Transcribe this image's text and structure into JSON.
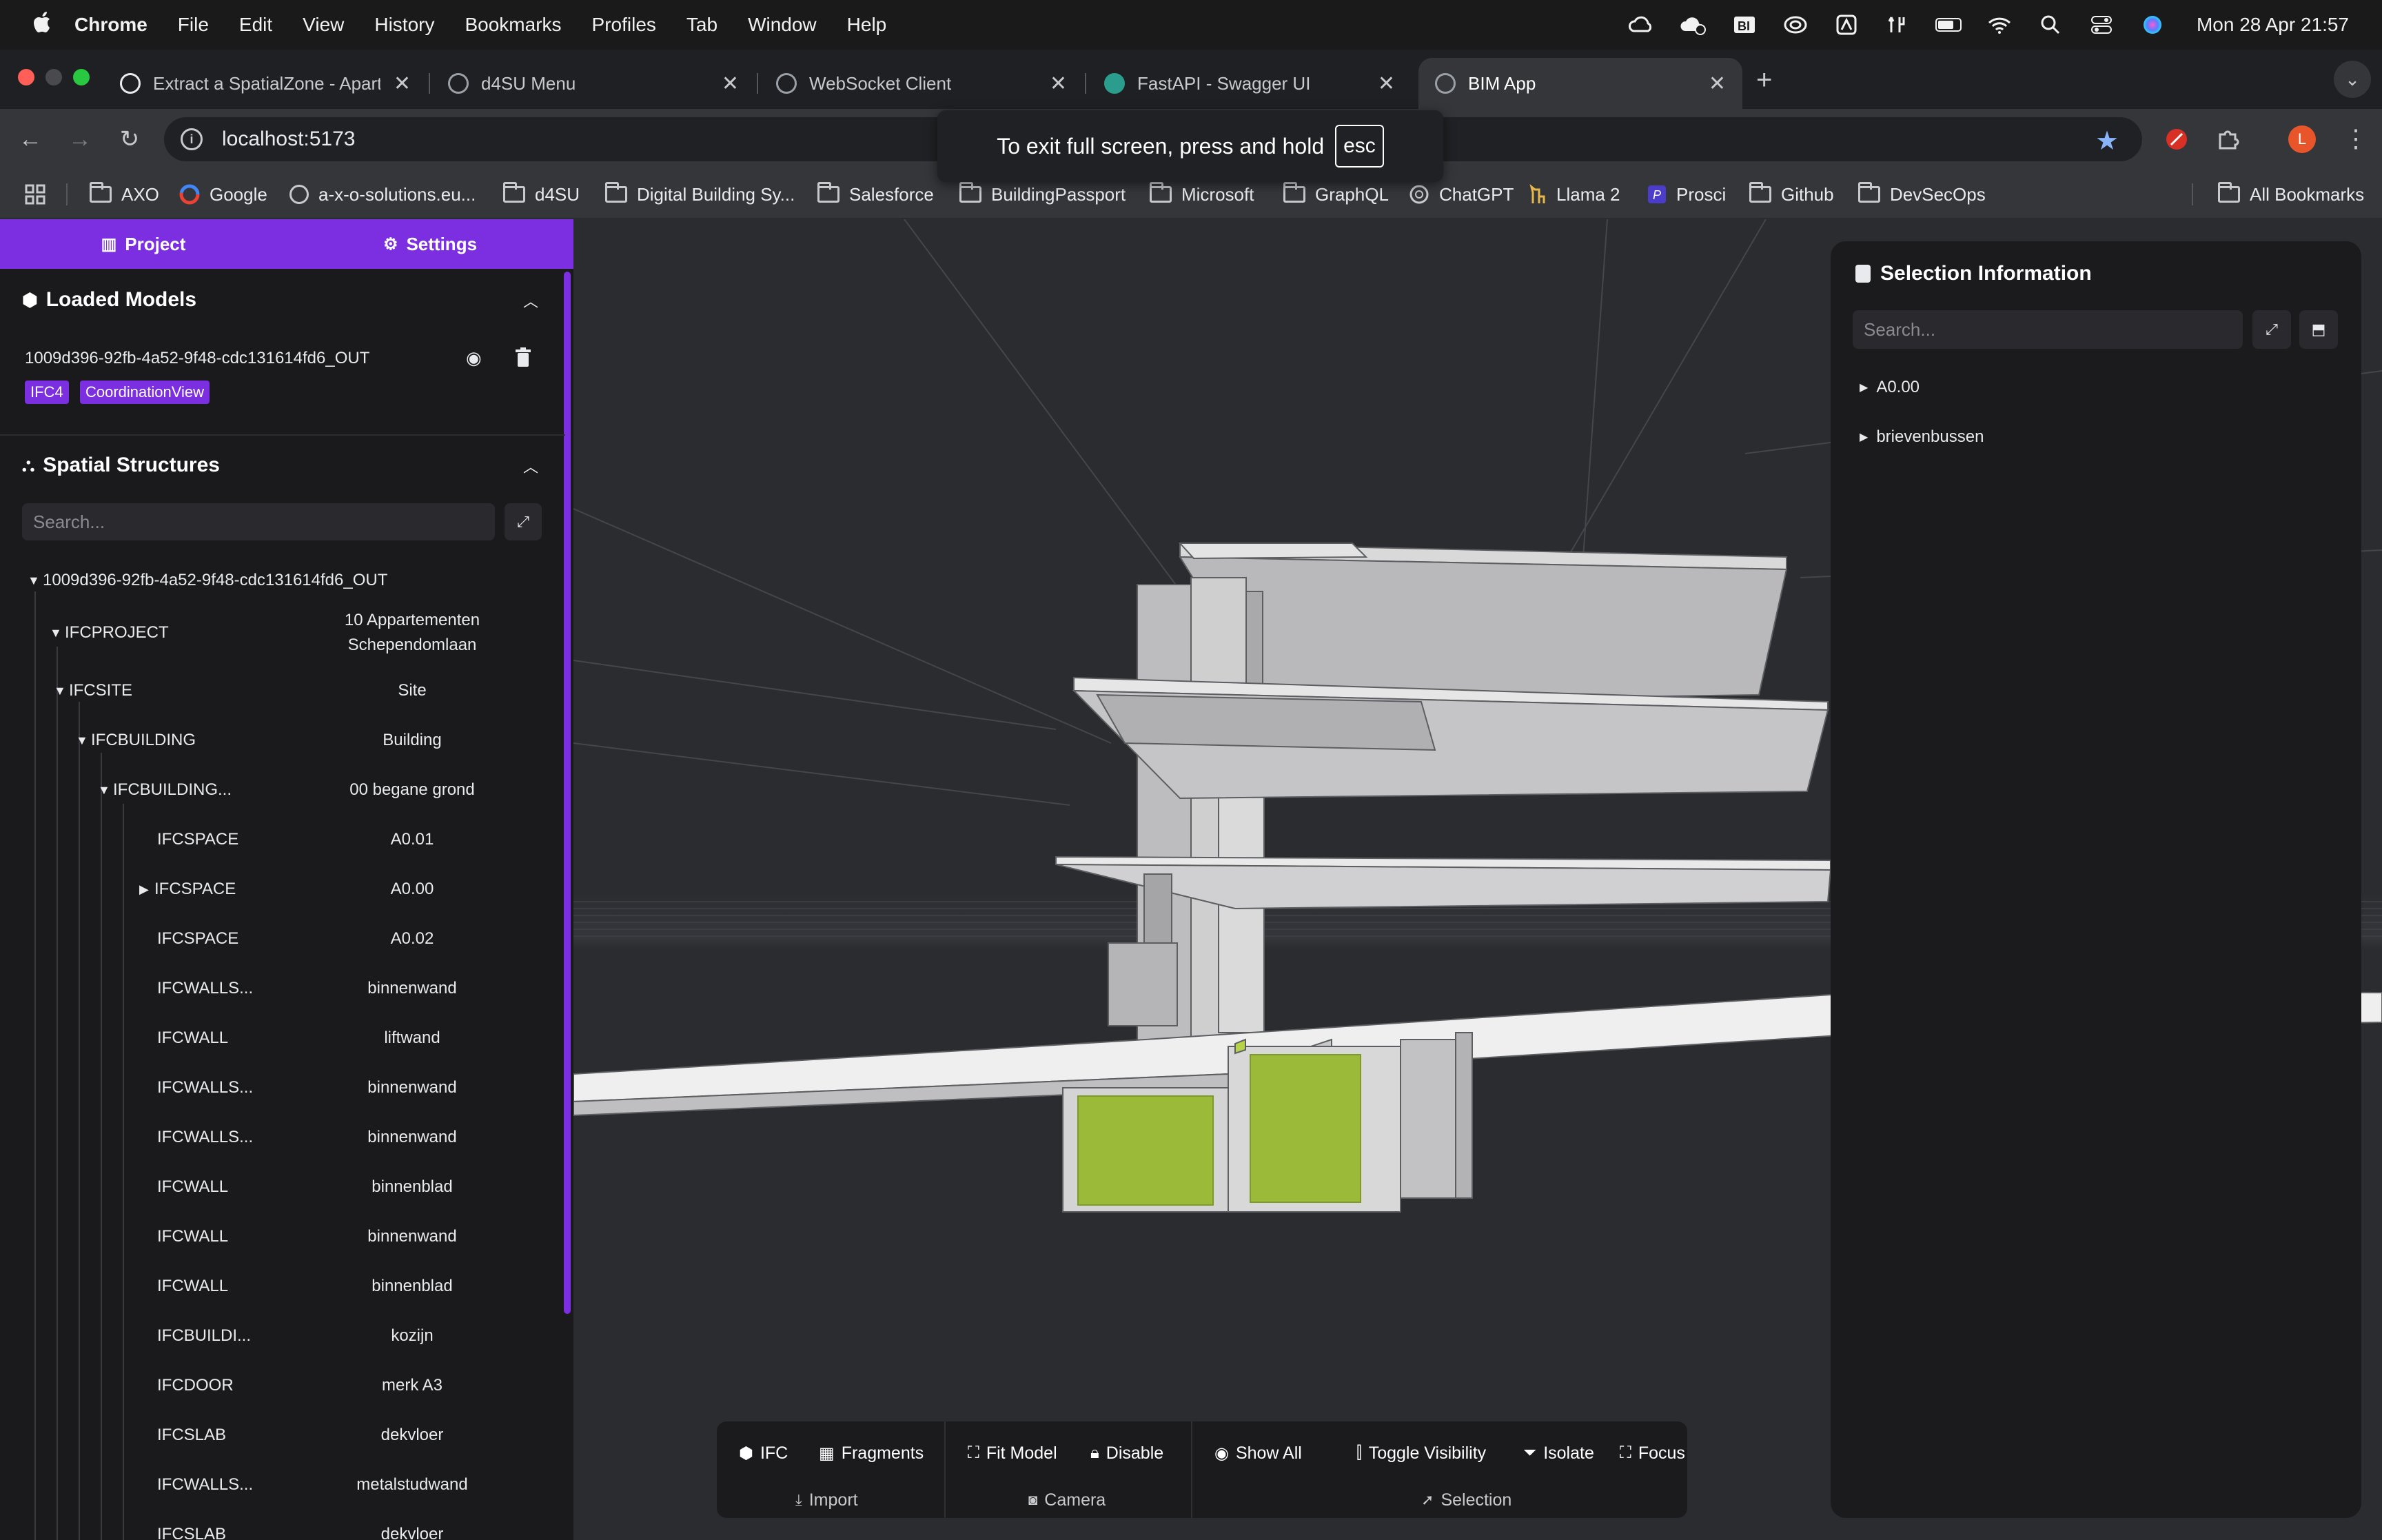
{
  "menubar": {
    "app": "Chrome",
    "items": [
      "File",
      "Edit",
      "View",
      "History",
      "Bookmarks",
      "Profiles",
      "Tab",
      "Window",
      "Help"
    ],
    "clock": "Mon 28 Apr  21:57"
  },
  "tabs": [
    {
      "title": "Extract a SpatialZone - Apart",
      "active": false
    },
    {
      "title": "d4SU Menu",
      "active": false
    },
    {
      "title": "WebSocket Client",
      "active": false
    },
    {
      "title": "FastAPI - Swagger UI",
      "active": false
    },
    {
      "title": "BIM App",
      "active": true
    }
  ],
  "omnibox": {
    "url": "localhost:5173"
  },
  "fullscreen_toast": {
    "text": "To exit full screen, press and hold",
    "key": "esc"
  },
  "bookmarks": [
    {
      "label": "AXO",
      "icon": "folder"
    },
    {
      "label": "Google",
      "icon": "google"
    },
    {
      "label": "a-x-o-solutions.eu...",
      "icon": "globe"
    },
    {
      "label": "d4SU",
      "icon": "folder"
    },
    {
      "label": "Digital Building Sy...",
      "icon": "folder"
    },
    {
      "label": "Salesforce",
      "icon": "folder"
    },
    {
      "label": "BuildingPassport",
      "icon": "folder"
    },
    {
      "label": "Microsoft",
      "icon": "folder"
    },
    {
      "label": "GraphQL",
      "icon": "folder"
    },
    {
      "label": "ChatGPT",
      "icon": "chatgpt"
    },
    {
      "label": "Llama 2",
      "icon": "llama"
    },
    {
      "label": "Prosci",
      "icon": "prosci"
    },
    {
      "label": "Github",
      "icon": "folder"
    },
    {
      "label": "DevSecOps",
      "icon": "folder"
    }
  ],
  "all_bookmarks": "All Bookmarks",
  "left_panel": {
    "tabs": {
      "project": "Project",
      "settings": "Settings"
    },
    "loaded_models": {
      "title": "Loaded Models",
      "model_name": "1009d396-92fb-4a52-9f48-cdc131614fd6_OUT",
      "badges": [
        "IFC4",
        "CoordinationView"
      ]
    },
    "spatial": {
      "title": "Spatial Structures",
      "search_placeholder": "Search...",
      "root": "1009d396-92fb-4a52-9f48-cdc131614fd6_OUT",
      "rows": [
        {
          "type": "IFCPROJECT",
          "name": "10 Appartementen Schependomlaan"
        },
        {
          "type": "IFCSITE",
          "name": "Site"
        },
        {
          "type": "IFCBUILDING",
          "name": "Building"
        },
        {
          "type": "IFCBUILDING...",
          "name": "00 begane grond"
        },
        {
          "type": "IFCSPACE",
          "name": "A0.01"
        },
        {
          "type": "IFCSPACE",
          "name": "A0.00"
        },
        {
          "type": "IFCSPACE",
          "name": "A0.02"
        },
        {
          "type": "IFCWALLS...",
          "name": "binnenwand"
        },
        {
          "type": "IFCWALL",
          "name": "liftwand"
        },
        {
          "type": "IFCWALLS...",
          "name": "binnenwand"
        },
        {
          "type": "IFCWALLS...",
          "name": "binnenwand"
        },
        {
          "type": "IFCWALL",
          "name": "binnenblad"
        },
        {
          "type": "IFCWALL",
          "name": "binnenwand"
        },
        {
          "type": "IFCWALL",
          "name": "binnenblad"
        },
        {
          "type": "IFCBUILDI...",
          "name": "kozijn"
        },
        {
          "type": "IFCDOOR",
          "name": "merk A3"
        },
        {
          "type": "IFCSLAB",
          "name": "dekvloer"
        },
        {
          "type": "IFCWALLS...",
          "name": "metalstudwand"
        },
        {
          "type": "IFCSLAB",
          "name": "dekvloer"
        }
      ]
    }
  },
  "right_panel": {
    "title": "Selection Information",
    "search_placeholder": "Search...",
    "items": [
      "A0.00",
      "brievenbussen"
    ]
  },
  "bottom_toolbar": {
    "groups": [
      {
        "label": "Import",
        "buttons": [
          "IFC",
          "Fragments"
        ]
      },
      {
        "label": "Camera",
        "buttons": [
          "Fit Model",
          "Disable"
        ]
      },
      {
        "label": "Selection",
        "buttons": [
          "Show All",
          "Toggle Visibility",
          "Isolate",
          "Focus"
        ]
      }
    ]
  },
  "colors": {
    "accent": "#7b2fe0",
    "panel_bg": "#1a1a1d",
    "viewport_bg": "#2a2b2f",
    "selection_highlight": "#9cba3a"
  }
}
